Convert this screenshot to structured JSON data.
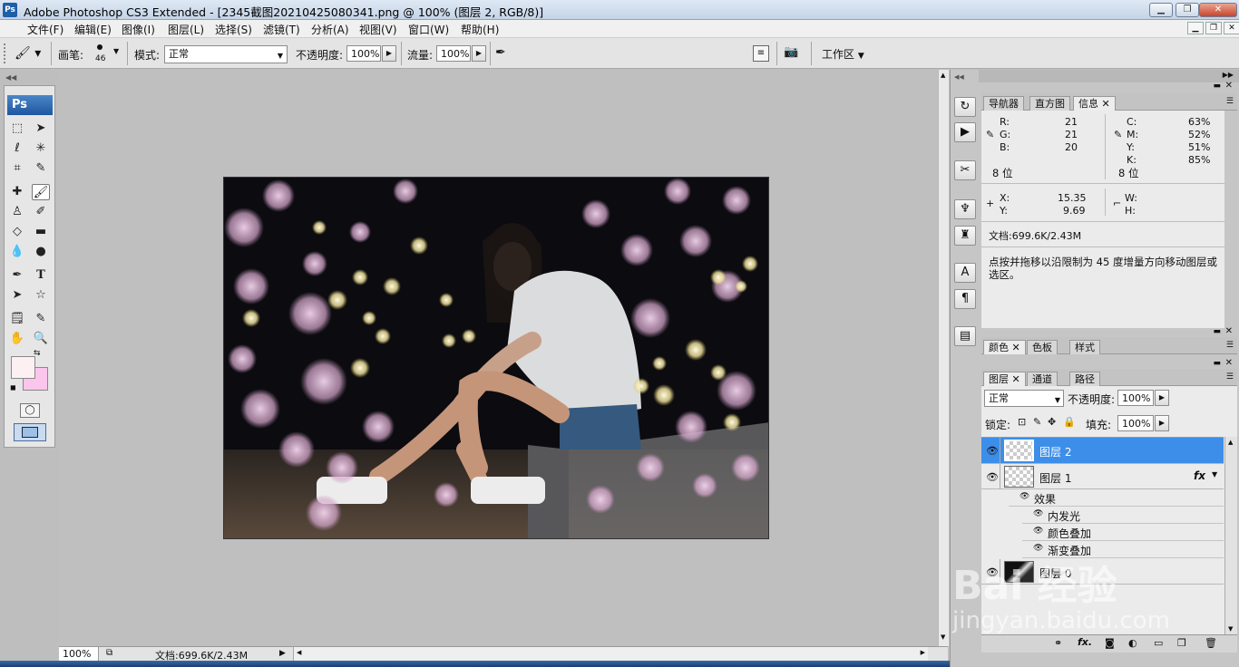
{
  "window": {
    "title": "Adobe Photoshop CS3 Extended - [2345截图20210425080341.png @ 100% (图层 2, RGB/8)]",
    "app_icon": "Ps",
    "controls": [
      "▁",
      "❐",
      "✕"
    ]
  },
  "menu": {
    "items": [
      "文件(F)",
      "编辑(E)",
      "图像(I)",
      "图层(L)",
      "选择(S)",
      "滤镜(T)",
      "分析(A)",
      "视图(V)",
      "窗口(W)",
      "帮助(H)"
    ],
    "doc_controls": [
      "▁",
      "❐",
      "✕"
    ]
  },
  "options": {
    "brush_label": "画笔:",
    "brush_size": "46",
    "mode_label": "模式:",
    "mode_value": "正常",
    "opacity_label": "不透明度:",
    "opacity_value": "100%",
    "flow_label": "流量:",
    "flow_value": "100%",
    "workspace_label": "工作区",
    "workspace_arrow": "▼"
  },
  "toolbox": {
    "logo": "Ps",
    "tools": [
      "marquee",
      "move",
      "lasso",
      "magic-wand",
      "crop",
      "slice",
      "healing",
      "brush",
      "stamp",
      "history-brush",
      "eraser",
      "gradient",
      "blur",
      "dodge",
      "pen",
      "type",
      "path-select",
      "shape",
      "notes",
      "eyedropper",
      "hand",
      "zoom"
    ],
    "foreground_color": "#fdf0f3",
    "background_color": "#fbc5ec"
  },
  "status": {
    "zoom": "100%",
    "doc_info": "文档:699.6K/2.43M"
  },
  "info_panel": {
    "tabs": [
      "导航器",
      "直方图",
      "信息"
    ],
    "active_tab": "信息",
    "rgb": [
      {
        "label": "R:",
        "value": "21"
      },
      {
        "label": "G:",
        "value": "21"
      },
      {
        "label": "B:",
        "value": "20"
      }
    ],
    "cmyk": [
      {
        "label": "C:",
        "value": "63%"
      },
      {
        "label": "M:",
        "value": "52%"
      },
      {
        "label": "Y:",
        "value": "51%"
      },
      {
        "label": "K:",
        "value": "85%"
      }
    ],
    "bits_left": "8 位",
    "bits_right": "8 位",
    "x_label": "X:",
    "x_value": "15.35",
    "y_label": "Y:",
    "y_value": "9.69",
    "w_label": "W:",
    "h_label": "H:",
    "doc_info": "文档:699.6K/2.43M",
    "hint": "点按并拖移以沿限制为 45 度增量方向移动图层或选区。"
  },
  "color_panel": {
    "tabs": [
      "颜色",
      "色板",
      "样式"
    ]
  },
  "layers_panel": {
    "tabs": [
      "图层",
      "通道",
      "路径"
    ],
    "blend_mode": "正常",
    "opacity_label": "不透明度:",
    "opacity_value": "100%",
    "lock_label": "锁定:",
    "fill_label": "填充:",
    "fill_value": "100%",
    "layers": [
      {
        "name": "图层 2",
        "selected": true
      },
      {
        "name": "图层 1",
        "selected": false,
        "fx": "fx"
      },
      {
        "name": "图层 0",
        "selected": false
      }
    ],
    "effects_label": "效果",
    "effects": [
      "内发光",
      "颜色叠加",
      "渐变叠加"
    ]
  },
  "watermark": {
    "logo": "Bai 经验",
    "url": "jingyan.baidu.com"
  }
}
